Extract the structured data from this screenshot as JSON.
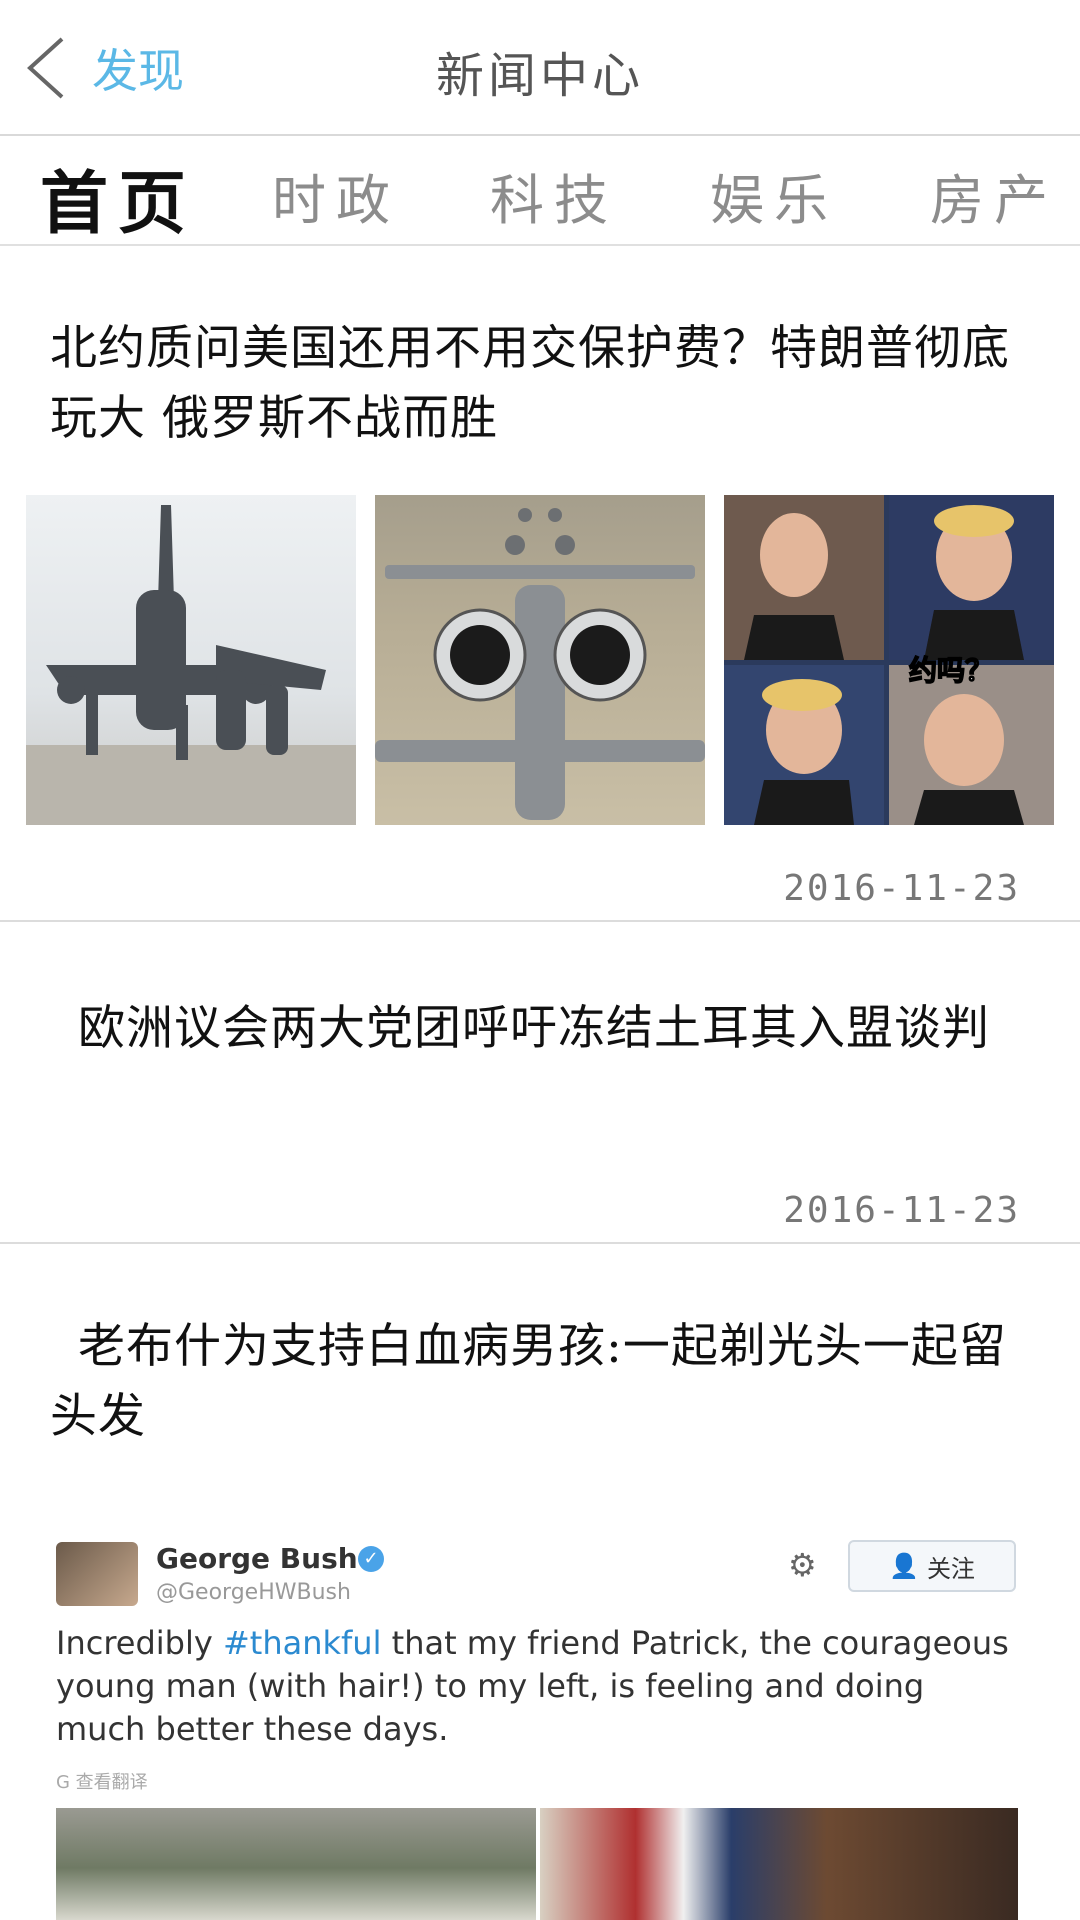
{
  "header": {
    "back_label": "发现",
    "title": "新闻中心"
  },
  "tabs": [
    {
      "label": "首页",
      "active": true
    },
    {
      "label": "时政",
      "active": false
    },
    {
      "label": "科技",
      "active": false
    },
    {
      "label": "娱乐",
      "active": false
    },
    {
      "label": "房产",
      "active": false
    }
  ],
  "articles": [
    {
      "headline": "北约质问美国还用不用交保护费？特朗普彻底玩大 俄罗斯不战而胜",
      "date": "2016-11-23",
      "thumbnail_captions": [
        "约吗？"
      ]
    },
    {
      "headline": "欧洲议会两大党团呼吁冻结土耳其入盟谈判",
      "date": "2016-11-23"
    },
    {
      "headline": "老布什为支持白血病男孩:一起剃光头一起留头发",
      "tweet": {
        "name": "George Bush",
        "handle": "@GeorgeHWBush",
        "follow_label": "关注",
        "text_before": "Incredibly ",
        "hashtag": "#thankful",
        "text_after": " that my friend Patrick, the courageous young man (with hair!) to my left, is feeling and doing much better these days.",
        "translate_label": "查看翻译"
      }
    }
  ],
  "colors": {
    "accent": "#5bb8e6",
    "hashtag": "#2b8ad0",
    "separator": "#dcdcdc"
  }
}
